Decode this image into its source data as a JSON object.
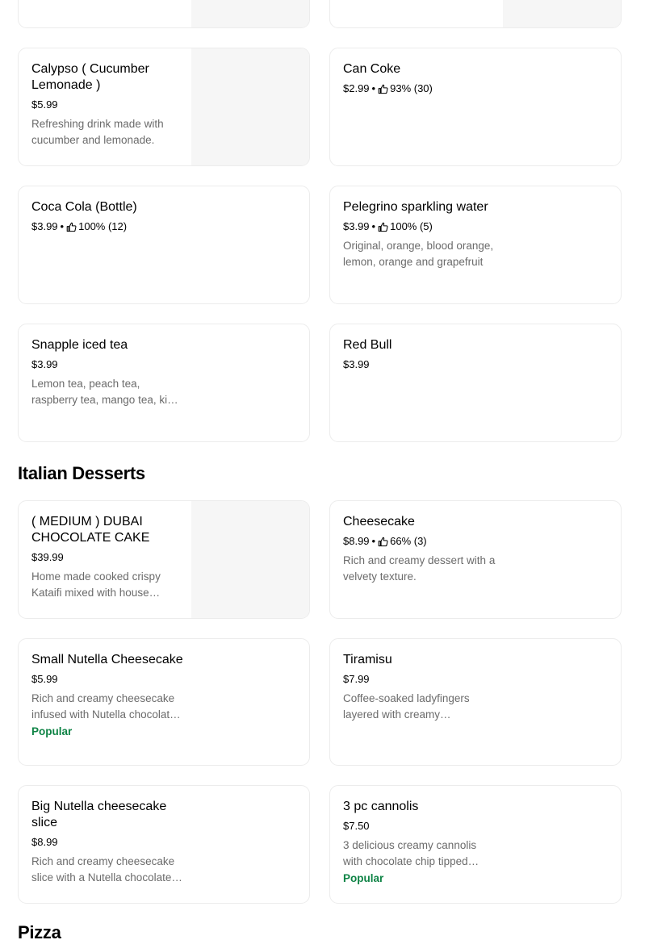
{
  "sections": {
    "drinks": {
      "items": [
        {
          "name": "",
          "price": "",
          "has_image": false
        },
        {
          "name": "",
          "price": "",
          "has_image": false
        },
        {
          "name": "Calypso ( Cucumber Lemonade )",
          "price": "$5.99",
          "rating": "",
          "description": "Refreshing drink made with cucumber and lemonade.",
          "badge": ""
        },
        {
          "name": "Can Coke",
          "price": "$2.99",
          "rating": "93% (30)",
          "description": "",
          "badge": ""
        },
        {
          "name": "Coca Cola (Bottle)",
          "price": "$3.99",
          "rating": "100% (12)",
          "description": "",
          "badge": ""
        },
        {
          "name": "Pelegrino sparkling water",
          "price": "$3.99",
          "rating": "100% (5)",
          "description": "Original, orange, blood orange, lemon, orange and grapefruit",
          "badge": ""
        },
        {
          "name": "Snapple iced tea",
          "price": "$3.99",
          "rating": "",
          "description": "Lemon tea, peach tea, raspberry tea, mango tea, kiwi strawberry",
          "badge": ""
        },
        {
          "name": "Red Bull",
          "price": "$3.99",
          "rating": "",
          "description": "",
          "badge": ""
        }
      ]
    },
    "italian_desserts": {
      "title": "Italian Desserts",
      "items": [
        {
          "name": "( MEDIUM ) DUBAI CHOCOLATE CAKE",
          "price": "$39.99",
          "rating": "",
          "description": "Home made cooked crispy Kataifi mixed with house made pistachio cream",
          "badge": ""
        },
        {
          "name": "Cheesecake",
          "price": "$8.99",
          "rating": "66% (3)",
          "description": "Rich and creamy dessert with a velvety texture.",
          "badge": ""
        },
        {
          "name": "Small Nutella Cheesecake",
          "price": "$5.99",
          "rating": "",
          "description": "Rich and creamy cheesecake infused with Nutella chocolate hazelnut spread.",
          "badge": "Popular"
        },
        {
          "name": "Tiramisu",
          "price": "$7.99",
          "rating": "",
          "description": "Coffee-soaked ladyfingers layered with creamy mascarpone and cocoa.",
          "badge": ""
        },
        {
          "name": "Big Nutella cheesecake slice",
          "price": "$8.99",
          "rating": "",
          "description": "Rich and creamy cheesecake slice with a Nutella chocolate hazelnut topping.",
          "badge": ""
        },
        {
          "name": "3 pc cannolis",
          "price": "$7.50",
          "rating": "",
          "description": "3 delicious creamy cannolis with chocolate chip tipped ends.",
          "badge": "Popular"
        }
      ]
    },
    "pizza": {
      "title": "Pizza"
    }
  },
  "rating_separator": "•",
  "colors": {
    "popular": "#0e8345",
    "description": "#6b6b6b",
    "card_border": "#ececec",
    "image_placeholder": "#f6f6f6"
  },
  "icons": {
    "rating": "thumbs-up-icon"
  }
}
